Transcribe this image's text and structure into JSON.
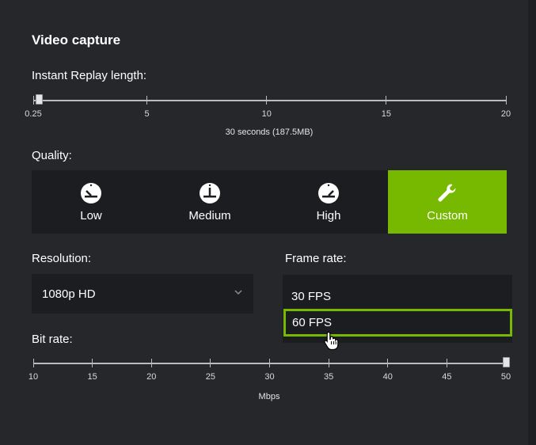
{
  "section": {
    "title": "Video capture"
  },
  "replay": {
    "label": "Instant Replay length:",
    "ticks": [
      "0.25",
      "5",
      "10",
      "15",
      "20"
    ],
    "value_text": "30 seconds (187.5MB)",
    "min": 0.25,
    "max": 20,
    "value": 0.5
  },
  "quality": {
    "label": "Quality:",
    "options": [
      {
        "label": "Low",
        "icon": "gauge-low-icon",
        "selected": false
      },
      {
        "label": "Medium",
        "icon": "gauge-medium-icon",
        "selected": false
      },
      {
        "label": "High",
        "icon": "gauge-high-icon",
        "selected": false
      },
      {
        "label": "Custom",
        "icon": "wrench-icon",
        "selected": true
      }
    ]
  },
  "resolution": {
    "label": "Resolution:",
    "value": "1080p HD"
  },
  "frame_rate": {
    "label": "Frame rate:",
    "options": [
      "30 FPS",
      "60 FPS"
    ],
    "highlighted": "60 FPS"
  },
  "bitrate": {
    "label": "Bit rate:",
    "ticks": [
      "10",
      "15",
      "20",
      "25",
      "30",
      "35",
      "40",
      "45",
      "50"
    ],
    "unit": "Mbps",
    "min": 10,
    "max": 50,
    "value": 50
  },
  "colors": {
    "accent": "#76b900",
    "background": "#25272b",
    "panel": "#1c1d20"
  }
}
